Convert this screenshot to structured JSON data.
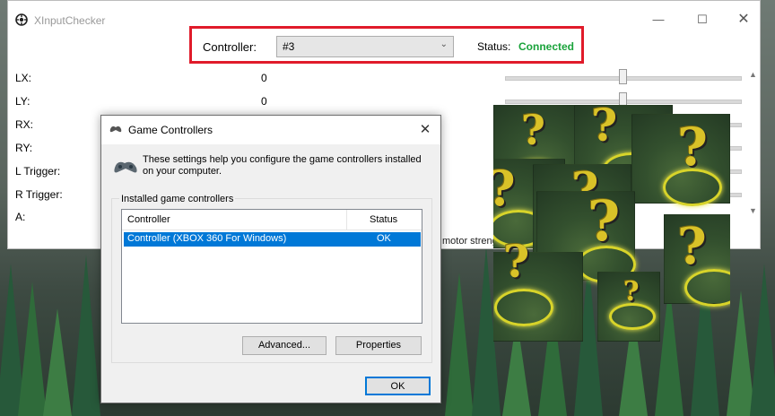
{
  "app": {
    "title": "XInputChecker",
    "controller_label": "Controller:",
    "controller_value": "#3",
    "status_label": "Status:",
    "status_value": "Connected",
    "status_color": "#1aa33b",
    "axes": [
      {
        "label": "LX:",
        "value": "0"
      },
      {
        "label": "LY:",
        "value": "0"
      },
      {
        "label": "RX:",
        "value": ""
      },
      {
        "label": "RY:",
        "value": ""
      },
      {
        "label": "L Trigger:",
        "value": ""
      },
      {
        "label": "R Trigger:",
        "value": ""
      },
      {
        "label": "A:",
        "value": ""
      }
    ],
    "motor_text": "motor streng",
    "window_buttons": {
      "minimize": "—",
      "maximize": "☐",
      "close": "✕"
    }
  },
  "dialog": {
    "title": "Game Controllers",
    "close": "✕",
    "info": "These settings help you configure the game controllers installed on your computer.",
    "group_label": "Installed game controllers",
    "columns": {
      "controller": "Controller",
      "status": "Status"
    },
    "rows": [
      {
        "name": "Controller (XBOX 360 For Windows)",
        "status": "OK"
      }
    ],
    "advanced_button": "Advanced...",
    "properties_button": "Properties",
    "ok_button": "OK"
  },
  "colors": {
    "highlight_border": "#e01b2a",
    "selection": "#0078d7"
  },
  "icons": [
    "app-icon",
    "gamepad-icon",
    "chevron-down-icon",
    "question-mark-icon"
  ]
}
